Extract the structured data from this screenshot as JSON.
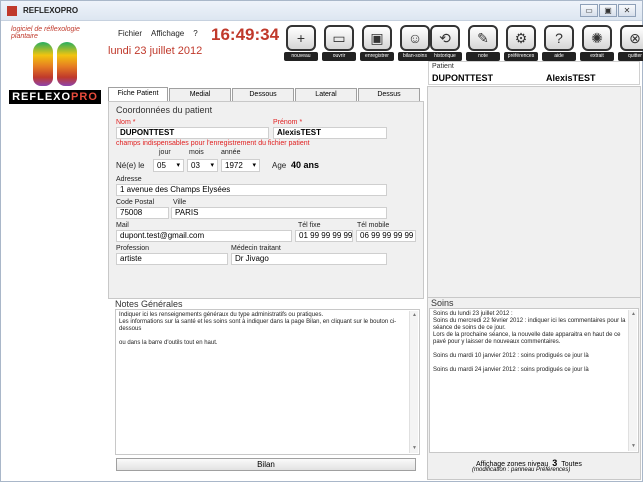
{
  "window": {
    "title": "REFLEXOPRO",
    "buttons": [
      "▭",
      "▣",
      "✕"
    ]
  },
  "logo": {
    "arc_text": "logiciel de réflexologie plantaire",
    "word_main": "REFLEXO",
    "word_pro": "PRO"
  },
  "menu": {
    "items": [
      "Fichier",
      "Affichage",
      "?"
    ]
  },
  "clock": "16:49:34",
  "date": "lundi 23 juillet 2012",
  "toolbar": {
    "tools": [
      {
        "label": "nouveau",
        "glyph": "+"
      },
      {
        "label": "ouvrir",
        "glyph": "▭"
      },
      {
        "label": "enregistrer",
        "glyph": "▣"
      },
      {
        "label": "bilan-soins",
        "glyph": "☺"
      }
    ],
    "tools2": [
      {
        "label": "historique",
        "glyph": "⟲"
      },
      {
        "label": "note",
        "glyph": "✎"
      },
      {
        "label": "préférences",
        "glyph": "⚙"
      },
      {
        "label": "aide",
        "glyph": "?"
      },
      {
        "label": "extrait",
        "glyph": "✺"
      },
      {
        "label": "quitter",
        "glyph": "⊗"
      }
    ]
  },
  "patient": {
    "label": "Patient",
    "nom": "DUPONTTEST",
    "prenom": "AlexisTEST"
  },
  "tabs": [
    "Fiche Patient",
    "Medial",
    "Dessous",
    "Lateral",
    "Dessus"
  ],
  "coord": {
    "title": "Coordonnées du patient",
    "nom_label": "Nom *",
    "prenom_label": "Prénom *",
    "nom_value": "DUPONTTEST",
    "prenom_value": "AlexisTEST",
    "required_note": "champs indispensables pour l'enregistrement du fichier patient",
    "jour_label": "jour",
    "mois_label": "mois",
    "annee_label": "année",
    "ne_le_label": "Né(e) le",
    "jour_value": "05",
    "mois_value": "03",
    "annee_value": "1972",
    "age_label": "Age",
    "age_value": "40 ans",
    "adresse_label": "Adresse",
    "adresse_value": "1 avenue des Champs Elysées",
    "cp_label": "Code Postal",
    "ville_label": "Ville",
    "cp_value": "75008",
    "ville_value": "PARIS",
    "mail_label": "Mail",
    "tel_fixe_label": "Tél fixe",
    "tel_mobile_label": "Tél mobile",
    "mail_value": "dupont.test@gmail.com",
    "tel_fixe_value": "01 99 99 99 99",
    "tel_mobile_value": "06 99 99 99 99",
    "profession_label": "Profession",
    "medecin_label": "Médecin traitant",
    "profession_value": "artiste",
    "medecin_value": "Dr Jivago"
  },
  "notes": {
    "title": "Notes Générales",
    "text_1": "Indiquer ici les renseignements généraux du type administratifs ou pratiques.",
    "text_2": "Les informations sur la santé et les soins sont à indiquer dans la page Bilan, en cliquant sur le bouton ci-dessous",
    "text_3": "ou dans la barre d'outils tout en haut."
  },
  "bilan_button": "Bilan",
  "soins": {
    "title": "Soins",
    "entries": [
      "Soins du lundi 23 juillet 2012 :",
      "Soins du mercredi 22 février 2012 : indiquer ici les commentaires pour la séance de soins de ce jour.",
      "Lors de la prochaine séance, la nouvelle date apparaitra en haut de ce pavé pour y laisser de nouveaux commentaires.",
      "Soins du mardi 10 janvier 2012 : soins prodigués ce jour là",
      "Soins du mardi 24 janvier 2012 : soins prodigués ce jour là"
    ],
    "affichage_label": "Affichage zones niveau",
    "affichage_level": "3",
    "affichage_all": "Toutes",
    "affichage_note": "(modification : panneau Préférences)"
  },
  "colors": {
    "accent_red": "#c0392b",
    "panel_bg": "#f0f0f0"
  }
}
